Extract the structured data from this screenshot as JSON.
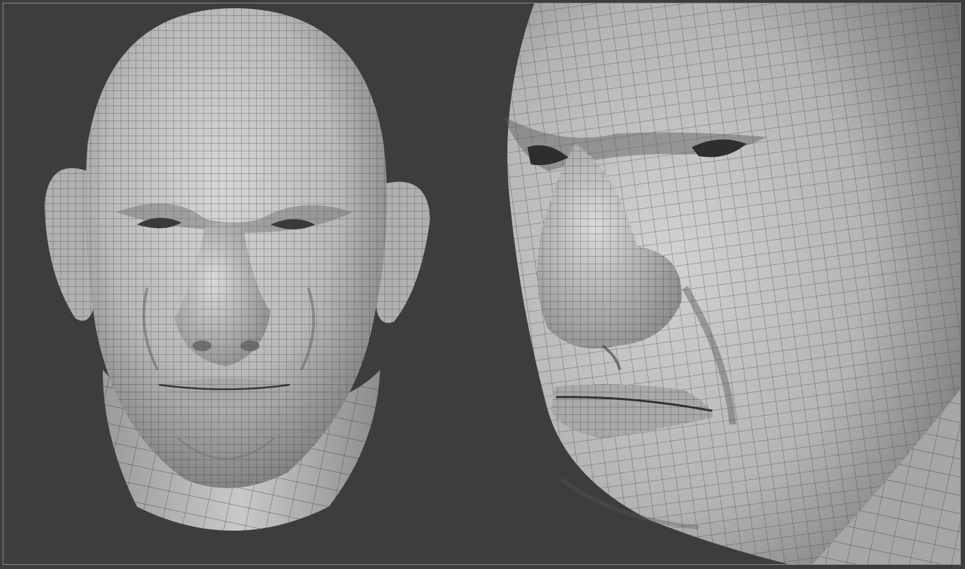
{
  "scene": {
    "background_color": "#3d3d3d",
    "border_color": "#8a8a8a",
    "mesh_fill_color": "#c8c8c8",
    "mesh_line_color": "#2a2a2a",
    "views": [
      {
        "name": "front-view",
        "subject": "wireframe-sculpted-head"
      },
      {
        "name": "three-quarter-closeup-view",
        "subject": "wireframe-sculpted-head"
      }
    ]
  }
}
